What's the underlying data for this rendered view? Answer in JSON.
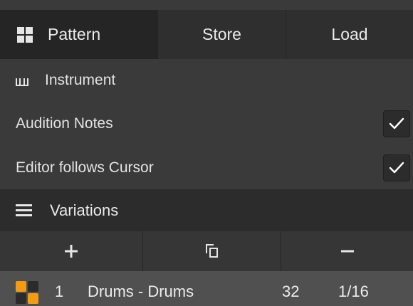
{
  "tabs": {
    "pattern": "Pattern",
    "store": "Store",
    "load": "Load"
  },
  "instrument": {
    "title": "Instrument",
    "audition_notes": {
      "label": "Audition Notes",
      "checked": true
    },
    "editor_follows_cursor": {
      "label": "Editor follows Cursor",
      "checked": true
    }
  },
  "variations": {
    "title": "Variations",
    "toolbar": {
      "add_icon": "plus-icon",
      "duplicate_icon": "duplicate-icon",
      "remove_icon": "minus-icon"
    },
    "items": [
      {
        "number": "1",
        "name": "Drums - Drums",
        "length": "32",
        "resolution": "1/16",
        "swatch_colors": [
          "#f39c12",
          "#2b2b2b",
          "#2b2b2b",
          "#f39c12"
        ]
      }
    ]
  },
  "colors": {
    "accent": "#f39c12",
    "panel_bg": "#3a3a3a",
    "header_bg": "#2c2c2c",
    "selected_row_bg": "#505050"
  }
}
